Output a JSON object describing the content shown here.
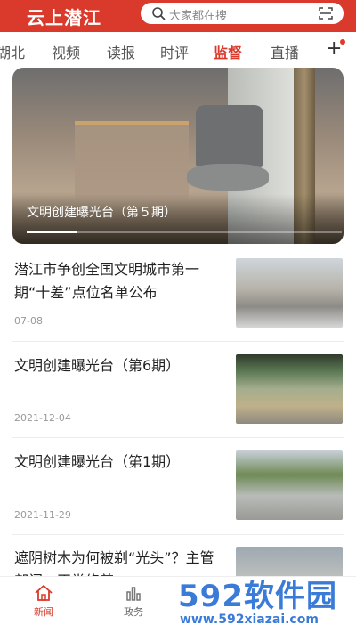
{
  "header": {
    "logo": "云上潜江",
    "search_placeholder": "大家都在搜",
    "search_icon": "search-icon",
    "scan_icon": "scan-icon",
    "bg_color": "#d93a2b"
  },
  "tabs": [
    "湖北",
    "视频",
    "读报",
    "时评",
    "监督",
    "直播"
  ],
  "active_tab": "监督",
  "hero": {
    "caption": "文明创建曝光台（第５期）",
    "progress": 0.16
  },
  "news": [
    {
      "title": "潜江市争创全国文明城市第一期“十差”点位名单公布",
      "date": "07-08"
    },
    {
      "title": "文明创建曝光台（第6期）",
      "date": "2021-12-04"
    },
    {
      "title": "文明创建曝光台（第1期）",
      "date": "2021-11-29"
    },
    {
      "title": "遮阴树木为何被剃“光头”？主管部门：正常修剪",
      "date": ""
    }
  ],
  "bottom_nav": [
    {
      "label": "新闻",
      "icon": "home-icon",
      "active": true
    },
    {
      "label": "政务",
      "icon": "chart-icon",
      "active": false
    }
  ],
  "watermark": {
    "brand": "592软件园",
    "url": "www.592xiazai.com"
  }
}
